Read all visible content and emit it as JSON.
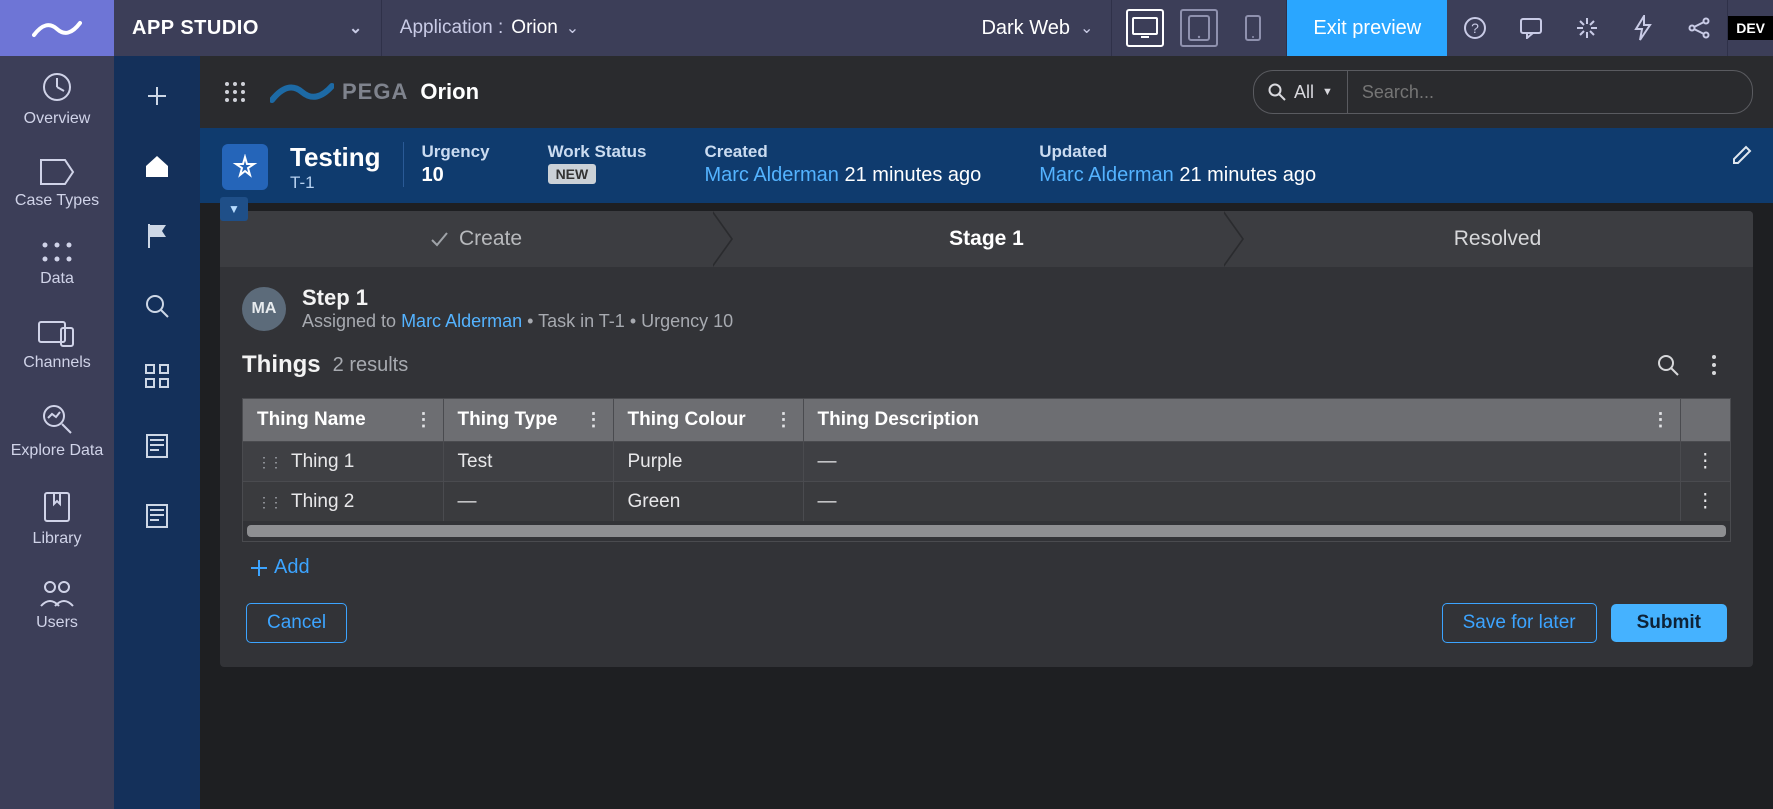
{
  "topbar": {
    "app_studio": "APP STUDIO",
    "application_label": "Application :",
    "application_value": "Orion",
    "theme": "Dark Web",
    "exit_preview": "Exit preview",
    "dev_badge": "DEV"
  },
  "sidebar": {
    "items": [
      {
        "label": "Overview"
      },
      {
        "label": "Case Types"
      },
      {
        "label": "Data"
      },
      {
        "label": "Channels"
      },
      {
        "label": "Explore Data"
      },
      {
        "label": "Library"
      },
      {
        "label": "Users"
      }
    ]
  },
  "app_header": {
    "brand": "PEGA",
    "app_name": "Orion",
    "search_scope": "All",
    "search_placeholder": "Search..."
  },
  "case": {
    "title": "Testing",
    "id": "T-1",
    "urgency_label": "Urgency",
    "urgency_value": "10",
    "work_status_label": "Work Status",
    "work_status_value": "NEW",
    "created_label": "Created",
    "created_user": "Marc Alderman",
    "created_time": "21 minutes ago",
    "updated_label": "Updated",
    "updated_user": "Marc Alderman",
    "updated_time": "21 minutes ago"
  },
  "stages": {
    "create": "Create",
    "stage1": "Stage 1",
    "resolved": "Resolved"
  },
  "step": {
    "title": "Step 1",
    "avatar": "MA",
    "assigned_prefix": "Assigned to ",
    "assigned_user": "Marc Alderman",
    "meta_sep": " • ",
    "task_in": "Task in T-1",
    "urgency": "Urgency 10"
  },
  "things": {
    "title": "Things",
    "count": "2 results",
    "columns": [
      "Thing Name",
      "Thing Type",
      "Thing Colour",
      "Thing Description"
    ],
    "rows": [
      {
        "name": "Thing 1",
        "type": "Test",
        "colour": "Purple",
        "description": "—"
      },
      {
        "name": "Thing 2",
        "type": "—",
        "colour": "Green",
        "description": "—"
      }
    ],
    "add_label": "Add"
  },
  "actions": {
    "cancel": "Cancel",
    "save": "Save for later",
    "submit": "Submit"
  }
}
